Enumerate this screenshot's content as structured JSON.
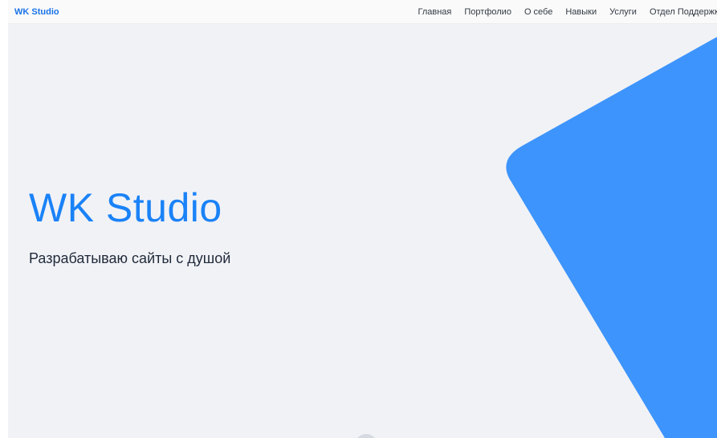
{
  "header": {
    "brand": "WK Studio",
    "nav": [
      {
        "label": "Главная"
      },
      {
        "label": "Портфолио"
      },
      {
        "label": "О себе"
      },
      {
        "label": "Навыки"
      },
      {
        "label": "Услуги"
      },
      {
        "label": "Отдел Поддержки"
      }
    ]
  },
  "hero": {
    "title": "WK Studio",
    "subtitle": "Разрабатываю сайты с душой"
  },
  "colors": {
    "accent": "#1a82f7",
    "shape": "#3d94fc",
    "background": "#f1f2f6"
  }
}
